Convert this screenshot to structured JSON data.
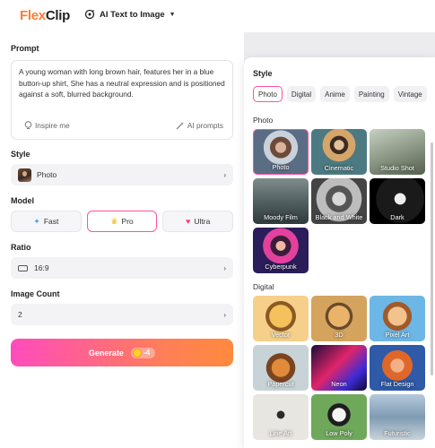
{
  "header": {
    "logo_flex": "Flex",
    "logo_clip": "Clip",
    "mode_label": "AI Text to Image"
  },
  "left": {
    "prompt_label": "Prompt",
    "prompt_text": "A young woman with long brown hair, features her in a blue button-up shirt, She has a neutral expression and is positioned against a soft, blurred background.",
    "inspire_label": "Inspire me",
    "ai_prompts_label": "AI prompts",
    "style_label": "Style",
    "style_value": "Photo",
    "model_label": "Model",
    "models": [
      {
        "label": "Fast",
        "active": false
      },
      {
        "label": "Pro",
        "active": true
      },
      {
        "label": "Ultra",
        "active": false
      }
    ],
    "ratio_label": "Ratio",
    "ratio_value": "16:9",
    "count_label": "Image Count",
    "count_value": "2",
    "generate_label": "Generate",
    "generate_cost": "-4"
  },
  "style_panel": {
    "title": "Style",
    "tabs": [
      "Photo",
      "Digital",
      "Anime",
      "Painting",
      "Vintage"
    ],
    "active_tab": "Photo",
    "photo_group_label": "Photo",
    "photo_styles": [
      "Photo",
      "Cinematic",
      "Studio Shot",
      "Moody Film",
      "Black and White",
      "Dark",
      "Cyberpunk"
    ],
    "digital_group_label": "Digital",
    "digital_styles": [
      "Vector",
      "3D",
      "Pixel Art",
      "Papercut",
      "Neon",
      "Flat Design",
      "Line Art",
      "Low Poly",
      "Futuristic"
    ],
    "selected_style": "Photo"
  },
  "colors": {
    "accent_pink": "#ff4fa3",
    "generate_start": "#ff4bbd",
    "generate_end": "#ff8a3d",
    "logo_orange": "#ff7a2f"
  }
}
